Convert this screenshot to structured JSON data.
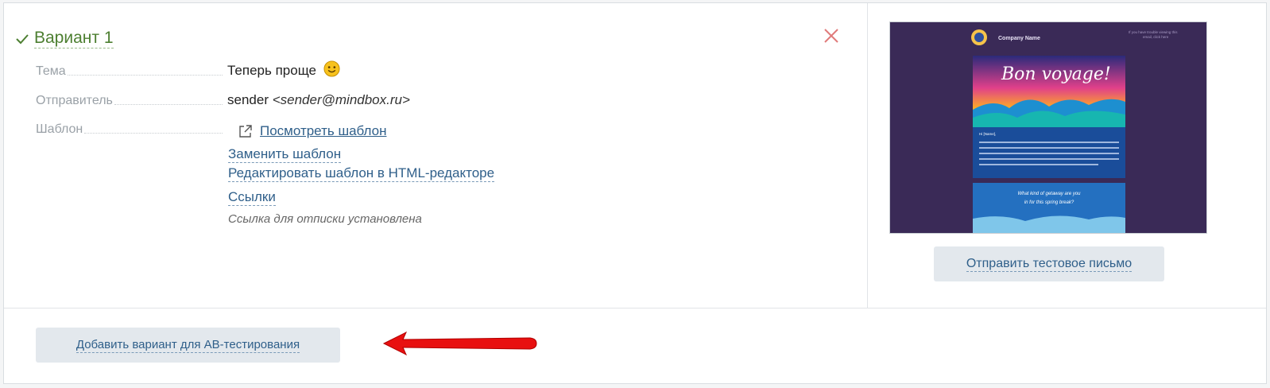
{
  "variant": {
    "title": "Вариант 1"
  },
  "fields": {
    "subject_label": "Тема",
    "subject_value": "Теперь проще",
    "sender_label": "Отправитель",
    "sender_name": "sender",
    "sender_email": "<sender@mindbox.ru>",
    "template_label": "Шаблон"
  },
  "template_actions": {
    "view": "Посмотреть шаблон",
    "replace": "Заменить шаблон",
    "edit_html": "Редактировать шаблон в HTML-редакторе",
    "links": "Ссылки",
    "unsubscribe_note": "Ссылка для отписки установлена"
  },
  "preview": {
    "company_name": "Company Name",
    "header_note": "If you have trouble viewing this email, click here",
    "hero_text": "Bon voyage!",
    "greeting": "Hi [Name],",
    "body_text": "When it comes time to exchanging for latitudes after the long winter season, it's nice to know that there are just as many getaway options as there are travellers. Whether you're looking for a quiet beach spot or somewhere to let your hair down and dance into the wee hours, we've got you covered with our quick-reference Spring Break Guide below.",
    "question_line1": "What kind of getaway are you",
    "question_line2": "in for this spring break?"
  },
  "buttons": {
    "send_test": "Отправить тестовое письмо",
    "add_ab_variant": "Добавить вариант для АВ-тестирования"
  },
  "colors": {
    "accent_green": "#4d7f31",
    "link_blue": "#2f5f8a",
    "close_red": "#e07a7a",
    "arrow_red": "#e81010"
  }
}
